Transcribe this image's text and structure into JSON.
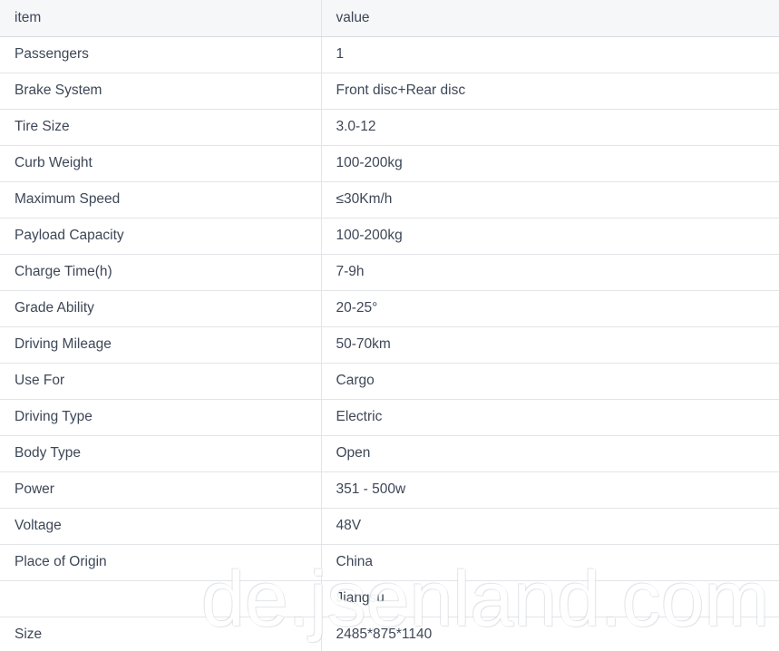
{
  "table": {
    "headers": {
      "item": "item",
      "value": "value"
    },
    "rows": [
      {
        "item": "Passengers",
        "value": "1"
      },
      {
        "item": "Brake System",
        "value": "Front disc+Rear disc"
      },
      {
        "item": "Tire Size",
        "value": "3.0-12"
      },
      {
        "item": "Curb Weight",
        "value": "100-200kg"
      },
      {
        "item": "Maximum Speed",
        "value": "≤30Km/h"
      },
      {
        "item": "Payload Capacity",
        "value": "100-200kg"
      },
      {
        "item": "Charge Time(h)",
        "value": "7-9h"
      },
      {
        "item": "Grade Ability",
        "value": "20-25°"
      },
      {
        "item": "Driving Mileage",
        "value": "50-70km"
      },
      {
        "item": "Use For",
        "value": "Cargo"
      },
      {
        "item": "Driving Type",
        "value": "Electric"
      },
      {
        "item": "Body Type",
        "value": "Open"
      },
      {
        "item": "Power",
        "value": "351 - 500w"
      },
      {
        "item": "Voltage",
        "value": "48V"
      },
      {
        "item": "Place of Origin",
        "value": "China"
      },
      {
        "item": "",
        "value": "Jiangsu"
      },
      {
        "item": "Size",
        "value": "2485*875*1140"
      }
    ]
  },
  "watermark": {
    "text": "de.jsenland.com"
  },
  "colors": {
    "text": "#3d4757",
    "header_bg": "#f6f7f9",
    "border": "#e2e4e8",
    "header_border": "#d7dae0",
    "watermark": "#ffffff"
  }
}
